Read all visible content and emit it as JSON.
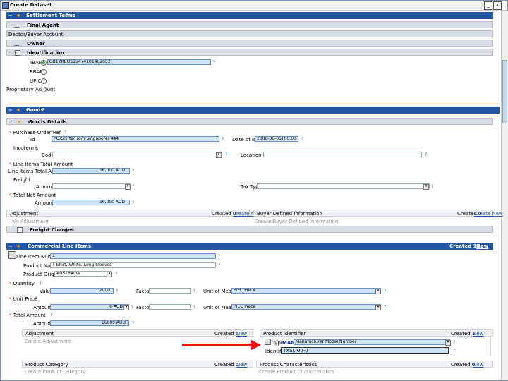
{
  "window": {
    "title": "Create Dataset",
    "help": "?"
  },
  "settlement": {
    "title": "Settlement Terms",
    "final_agent": "Final Agent",
    "debtor_account": "Debtor/Buyer Account",
    "owner": "Owner",
    "identification": "Identification"
  },
  "ident": {
    "iban_label": "IBAN",
    "iban_value": "GB12RBOS15474101462652",
    "bban_label": "BBAN",
    "upic_label": "UPIC",
    "prop_label": "Proprietary Account"
  },
  "goods": {
    "title": "Goods",
    "details_title": "Goods Details",
    "purchase_order": "Purchase Order Ref",
    "id_label": "Id",
    "id_value": "PO/Shirts/From Singapore/ 444",
    "date_label": "Date of Issue",
    "date_value": "2008-06-06T00:00:00",
    "incoterms": "Incoterms",
    "code_label": "Code",
    "location_label": "Location",
    "lineitems_total": "Line Items Total Amount",
    "lineitems_total_lbl": "Line Items Total Amount",
    "lineitems_total_value": "16,000 AUD",
    "freight": "Freight",
    "amount_label": "Amount",
    "tax_type_label": "Tax Type",
    "total_net": "Total Net Amount",
    "total_net_value": "16,000 AUD",
    "adjustment": "Adjustment",
    "create_new": "Create New",
    "no_adj": "No Adjustment",
    "created": "Created 0",
    "buyer_defined": "Buyer Defined Information",
    "no_buyer": "Create Buyer Defined Information",
    "freight_charges": "Freight Charges"
  },
  "commercial": {
    "title": "Commercial Line Items",
    "created": "Created 12",
    "line_item_number": "Line Item Number",
    "line_item_value": "1",
    "product_name": "Product Name",
    "product_value": "T Shirt, White, Long Sleeves",
    "product_origin": "Product Origin",
    "product_origin_value": "AUSTRALIA",
    "quantity": "Quantity",
    "value_label": "Value",
    "value_value": "2000",
    "factor_label": "Factor",
    "uom_label": "Unit of Measure",
    "uom_value": "PIEC Piece",
    "unit_price": "Unit Price",
    "amount_label": "Amount",
    "price_value": "8 AUD",
    "factor2_label": "Factor",
    "uom2_label": "Unit of Measure",
    "uom2_value": "PIEC Piece",
    "total_amount": "Total Amount",
    "total_value": "16000 AUD",
    "adjustment": "Adjustment",
    "product_identifier": "Product Identifier",
    "no_adj": "Create Adjustment",
    "type_label": "Type",
    "type_value": "MAN",
    "type_desc": "Manufacturer Model Number",
    "identifier_label": "Identifier",
    "identifier_value": "TXSL-00-0",
    "product_category": "Product Category",
    "product_char": "Product Characteristics",
    "no_cat": "Create Product Category",
    "no_char": "Create Product Characteristics",
    "created0": "Created 0",
    "created1": "Created 1",
    "new": "New",
    "create_new": "Create New"
  },
  "help_q": "?",
  "colors": {
    "blue_bar": "#2255a4",
    "arrow": "#e11111",
    "highlight": "#cde3f8"
  }
}
